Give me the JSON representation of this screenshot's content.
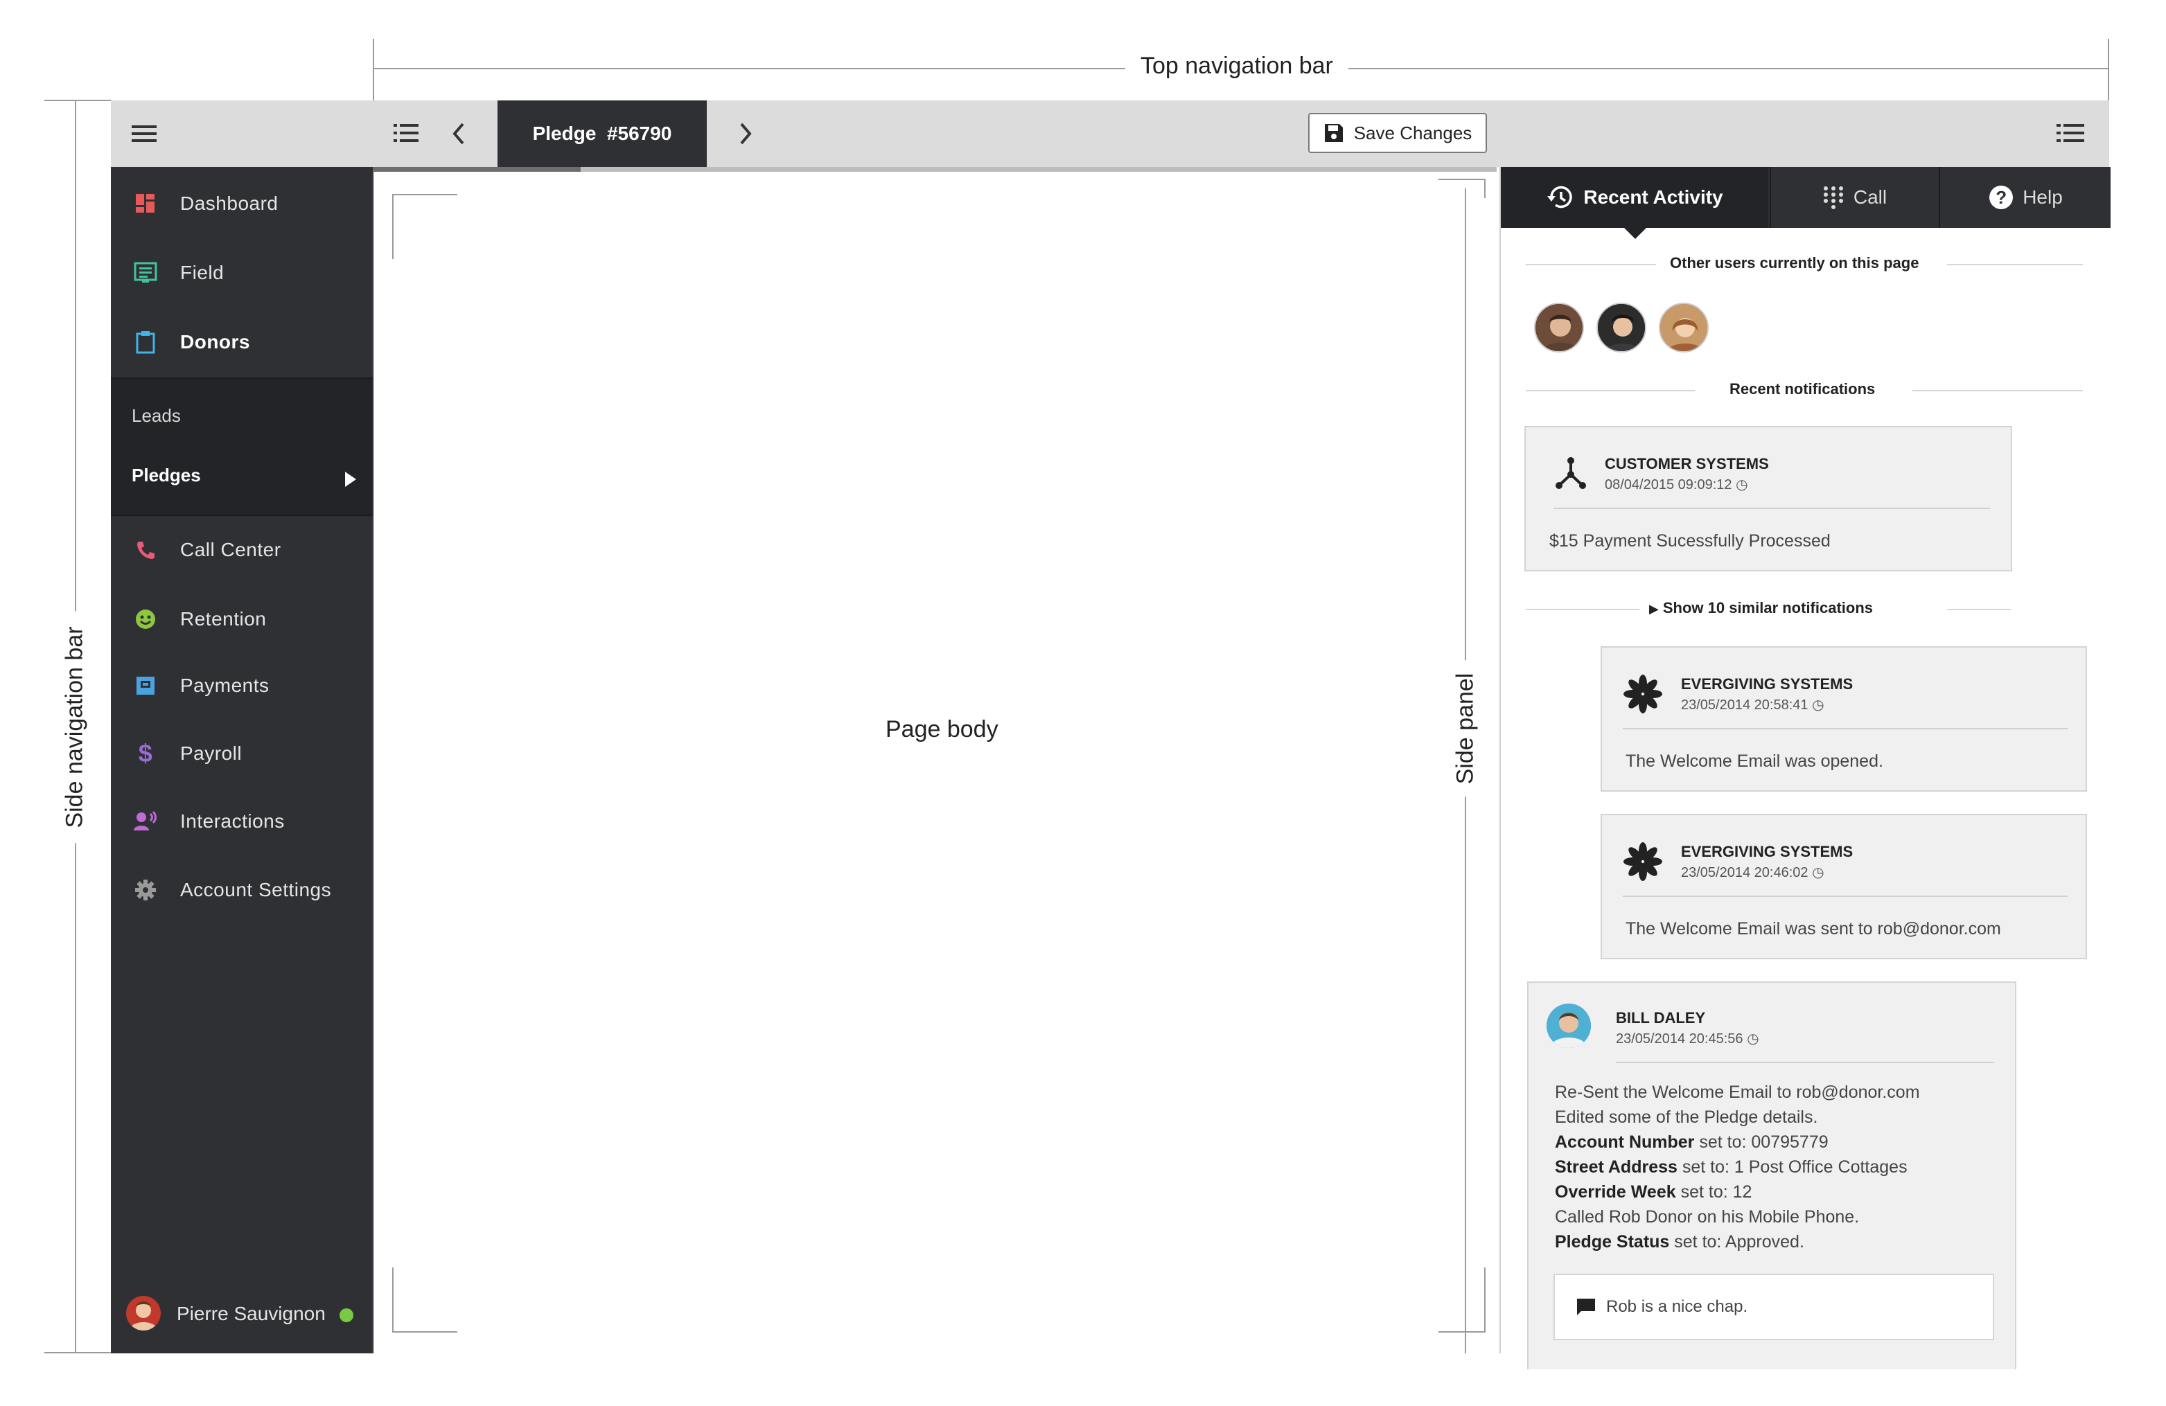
{
  "annotations": {
    "top_nav": "Top navigation bar",
    "side_nav": "Side navigation bar",
    "side_panel": "Side panel",
    "page_body": "Page body"
  },
  "topbar": {
    "tab_label": "Pledge  #56790",
    "save_label": "Save Changes"
  },
  "sidebar": {
    "items": [
      {
        "label": "Dashboard",
        "icon": "dashboard-icon",
        "color": "#e85a5a"
      },
      {
        "label": "Field",
        "icon": "field-icon",
        "color": "#3fc4a0"
      },
      {
        "label": "Donors",
        "icon": "clipboard-icon",
        "color": "#3fb5e6"
      },
      {
        "label": "Call Center",
        "icon": "phone-icon",
        "color": "#e85a7a"
      },
      {
        "label": "Retention",
        "icon": "smiley-icon",
        "color": "#8ec63f"
      },
      {
        "label": "Payments",
        "icon": "payment-icon",
        "color": "#4aa3df"
      },
      {
        "label": "Payroll",
        "icon": "dollar-icon",
        "color": "#9b6ad6"
      },
      {
        "label": "Interactions",
        "icon": "person-voice-icon",
        "color": "#c06ad6"
      },
      {
        "label": "Account Settings",
        "icon": "gear-icon",
        "color": "#9a9a9a"
      }
    ],
    "sub_items": [
      "Leads",
      "Pledges"
    ],
    "user_name": "Pierre Sauvignon",
    "status_color": "#7ac943"
  },
  "side_panel": {
    "tabs": [
      "Recent Activity",
      "Call",
      "Help"
    ],
    "users_title": "Other users currently on this page",
    "notifications_title": "Recent notifications",
    "show_similar": "Show 10 similar notifications",
    "notifications": [
      {
        "title": "CUSTOMER SYSTEMS",
        "time": "08/04/2015 09:09:12",
        "body": "$15 Payment Sucessfully Processed"
      },
      {
        "title": "EVERGIVING SYSTEMS",
        "time": "23/05/2014 20:58:41",
        "body": "The Welcome Email was opened."
      },
      {
        "title": "EVERGIVING SYSTEMS",
        "time": "23/05/2014 20:46:02",
        "body": "The Welcome Email was sent to rob@donor.com"
      }
    ],
    "user_activity": {
      "name": "BILL DALEY",
      "time": "23/05/2014 20:45:56",
      "lines": [
        {
          "bold": "",
          "text": "Re-Sent the Welcome Email to rob@donor.com"
        },
        {
          "bold": "",
          "text": "Edited some of the Pledge details."
        },
        {
          "bold": "Account Number",
          "text": " set to: 00795779"
        },
        {
          "bold": "Street Address",
          "text": " set to: 1 Post Office Cottages"
        },
        {
          "bold": "Override Week",
          "text": " set to: 12"
        },
        {
          "bold": "",
          "text": "Called Rob Donor on his Mobile Phone."
        },
        {
          "bold": "Pledge Status",
          "text": " set to: Approved."
        }
      ],
      "comment": "Rob is a nice chap."
    }
  }
}
